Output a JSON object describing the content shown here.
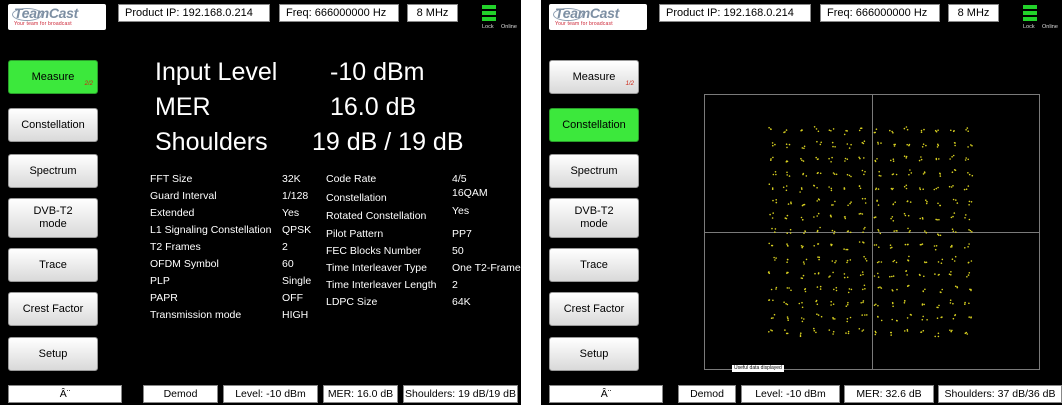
{
  "left": {
    "header": {
      "product_ip": "Product IP:  192.168.0.214",
      "freq": "Freq: 666000000 Hz",
      "bandwidth": "8 MHz",
      "lock": "Lock",
      "online": "Online"
    },
    "logo": {
      "name": "TeamCast",
      "tagline": "Your team for broadcast"
    },
    "menu": [
      {
        "label": "Measure",
        "page": "2/2",
        "active": true
      },
      {
        "label": "Constellation",
        "active": false
      },
      {
        "label": "Spectrum",
        "active": false
      },
      {
        "label": "DVB-T2 mode",
        "active": false
      },
      {
        "label": "Trace",
        "active": false
      },
      {
        "label": "Crest Factor",
        "active": false
      },
      {
        "label": "Setup",
        "active": false
      }
    ],
    "big": {
      "input_level_label": "Input Level",
      "input_level_value": "-10 dBm",
      "mer_label": "MER",
      "mer_value": "16.0 dB",
      "shoulders_label": "Shoulders",
      "shoulders_value": "19 dB / 19 dB"
    },
    "params_col1": [
      {
        "label": "FFT Size",
        "value": "32K"
      },
      {
        "label": "Guard Interval",
        "value": "1/128"
      },
      {
        "label": "Extended",
        "value": "Yes"
      },
      {
        "label": "L1 Signaling Constellation",
        "value": "QPSK"
      },
      {
        "label": "T2 Frames",
        "value": "2"
      },
      {
        "label": "OFDM Symbol",
        "value": "60"
      },
      {
        "label": "PLP",
        "value": "Single"
      },
      {
        "label": "PAPR",
        "value": "OFF"
      },
      {
        "label": "Transmission mode",
        "value": "HIGH"
      }
    ],
    "params_col2": [
      {
        "label": "Code Rate",
        "value": "4/5"
      },
      {
        "label": "Constellation",
        "value": "16QAM"
      },
      {
        "label": "Rotated Constellation",
        "value": "Yes"
      },
      {
        "label": "Pilot Pattern",
        "value": "PP7"
      },
      {
        "label": "FEC Blocks Number",
        "value": "50"
      },
      {
        "label": "Time Interleaver Type",
        "value": "One T2-Frame"
      },
      {
        "label": "Time Interleaver Length",
        "value": "2"
      },
      {
        "label": "LDPC Size",
        "value": "64K"
      }
    ],
    "status": {
      "arrow": "Â¨",
      "demod": "Demod",
      "level": "Level: -10 dBm",
      "mer": "MER: 16.0 dB",
      "shoulders": "Shoulders: 19 dB/19 dB"
    }
  },
  "right": {
    "header": {
      "product_ip": "Product IP:  192.168.0.214",
      "freq": "Freq: 666000000 Hz",
      "bandwidth": "8 MHz",
      "lock": "Lock",
      "online": "Online"
    },
    "logo": {
      "name": "TeamCast",
      "tagline": "Your team for broadcast"
    },
    "menu": [
      {
        "label": "Measure",
        "page": "1/2",
        "active": false
      },
      {
        "label": "Constellation",
        "active": true
      },
      {
        "label": "Spectrum",
        "active": false
      },
      {
        "label": "DVB-T2 mode",
        "active": false
      },
      {
        "label": "Trace",
        "active": false
      },
      {
        "label": "Crest Factor",
        "active": false
      },
      {
        "label": "Setup",
        "active": false
      }
    ],
    "constellation_note": "Useful data displayed",
    "status": {
      "arrow": "Â¨",
      "demod": "Demod",
      "level": "Level: -10 dBm",
      "mer": "MER: 32.6 dB",
      "shoulders": "Shoulders: 37 dB/36 dB"
    }
  },
  "colors": {
    "active_green": "#3ce83c",
    "lock_green": "#22d22a",
    "constellation_point": "#d8d020",
    "page_indicator": "#cc2211"
  }
}
